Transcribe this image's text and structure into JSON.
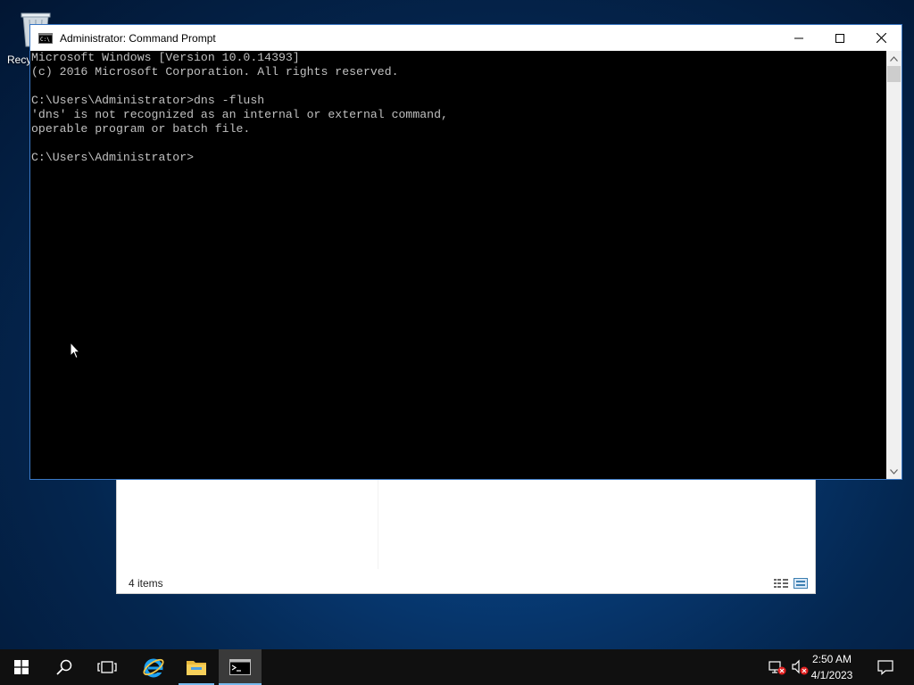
{
  "desktop": {
    "recycle_bin_label": "Recy"
  },
  "explorer": {
    "status_text": "4 items"
  },
  "cmd": {
    "title": "Administrator: Command Prompt",
    "lines": [
      "Microsoft Windows [Version 10.0.14393]",
      "(c) 2016 Microsoft Corporation. All rights reserved.",
      "",
      "C:\\Users\\Administrator>dns -flush",
      "'dns' is not recognized as an internal or external command,",
      "operable program or batch file.",
      "",
      "C:\\Users\\Administrator>"
    ]
  },
  "taskbar": {
    "time": "2:50 AM",
    "date": "4/1/2023",
    "items": [
      "start-icon",
      "search-icon",
      "task-view-icon",
      "internet-explorer-icon",
      "file-explorer-icon",
      "command-prompt-icon"
    ]
  },
  "colors": {
    "console_text": "#c0c0c0",
    "console_bg": "#000000",
    "taskbar_bg": "#101010",
    "accent": "#76b9ed"
  }
}
